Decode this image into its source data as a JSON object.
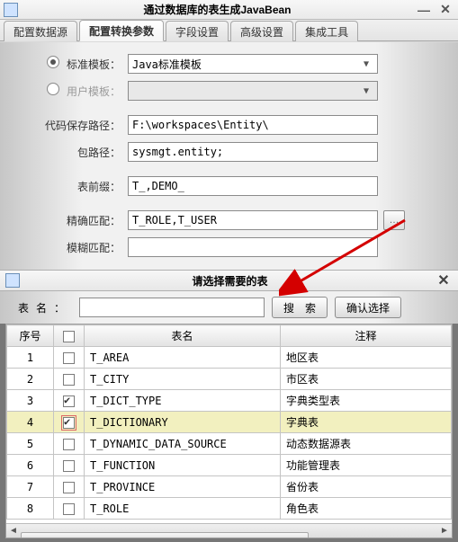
{
  "window1": {
    "title": "通过数据库的表生成JavaBean",
    "tabs": [
      "配置数据源",
      "配置转换参数",
      "字段设置",
      "高级设置",
      "集成工具"
    ],
    "active_tab_index": 1,
    "form": {
      "std_template_label": "标准模板：",
      "std_template_value": "Java标准模板",
      "user_template_label": "用户模板：",
      "save_path_label": "代码保存路径：",
      "save_path_value": "F:\\workspaces\\Entity\\",
      "pkg_label": "包路径：",
      "pkg_value": "sysmgt.entity;",
      "prefix_label": "表前缀：",
      "prefix_value": "T_,DEMO_",
      "exact_label": "精确匹配：",
      "exact_value": "T_ROLE,T_USER",
      "fuzzy_label": "模糊匹配："
    }
  },
  "window2": {
    "title": "请选择需要的表",
    "search_label": "表名：",
    "search_btn": "搜　索",
    "confirm_btn": "确认选择",
    "columns": {
      "idx": "序号",
      "name": "表名",
      "comment": "注释"
    },
    "rows": [
      {
        "idx": "1",
        "checked": false,
        "name": "T_AREA",
        "comment": "地区表"
      },
      {
        "idx": "2",
        "checked": false,
        "name": "T_CITY",
        "comment": "市区表"
      },
      {
        "idx": "3",
        "checked": true,
        "name": "T_DICT_TYPE",
        "comment": "字典类型表"
      },
      {
        "idx": "4",
        "checked": true,
        "name": "T_DICTIONARY",
        "comment": "字典表",
        "selected": true,
        "highlight": true
      },
      {
        "idx": "5",
        "checked": false,
        "name": "T_DYNAMIC_DATA_SOURCE",
        "comment": "动态数据源表"
      },
      {
        "idx": "6",
        "checked": false,
        "name": "T_FUNCTION",
        "comment": "功能管理表"
      },
      {
        "idx": "7",
        "checked": false,
        "name": "T_PROVINCE",
        "comment": "省份表"
      },
      {
        "idx": "8",
        "checked": false,
        "name": "T_ROLE",
        "comment": "角色表"
      }
    ]
  }
}
